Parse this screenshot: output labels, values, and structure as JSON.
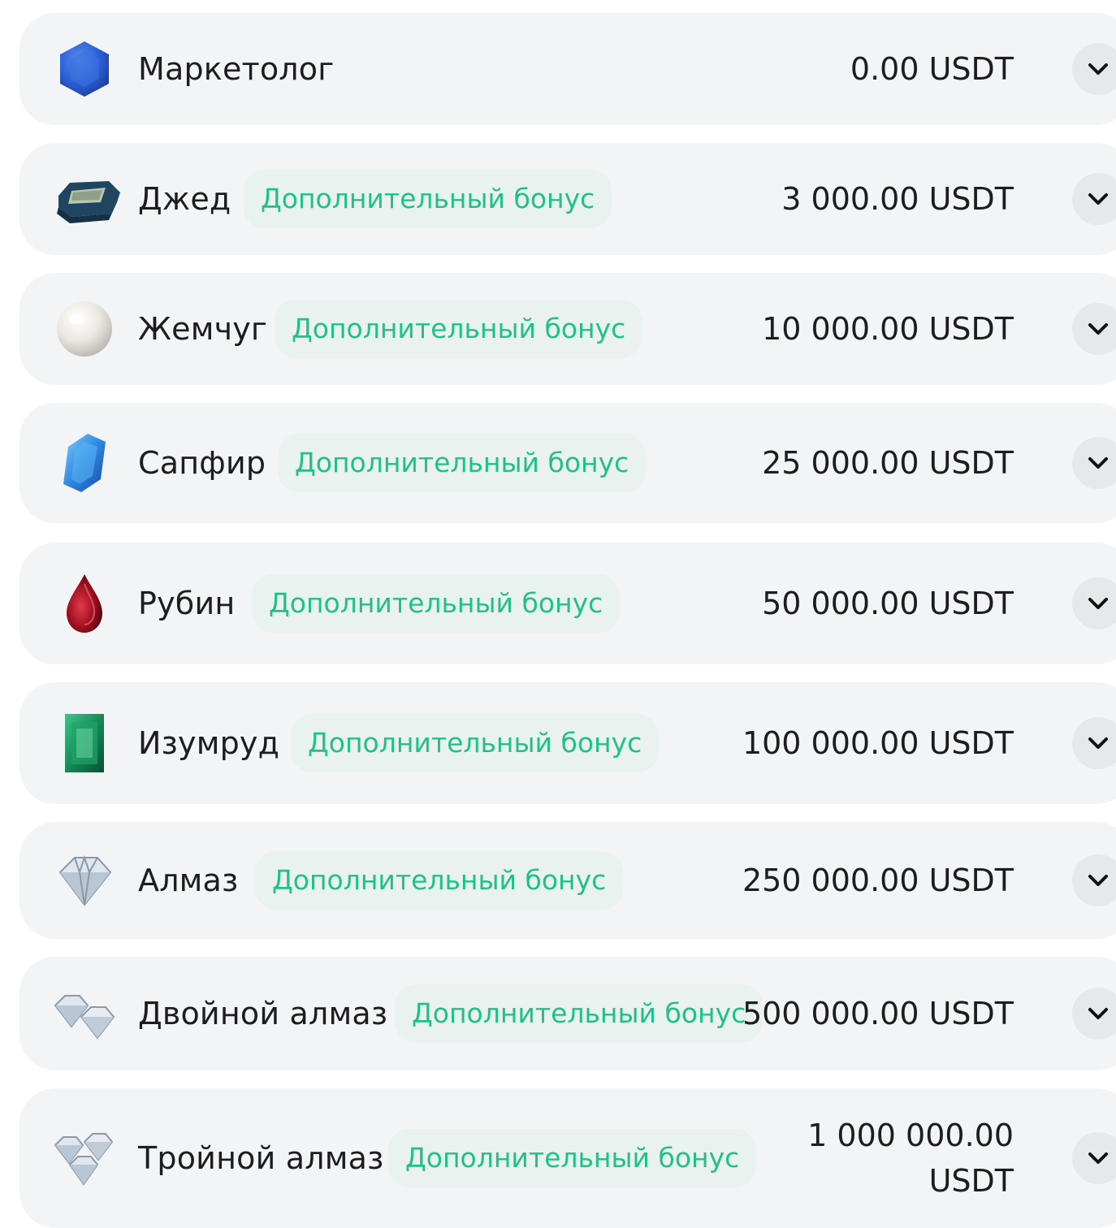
{
  "tiers": [
    {
      "name": "Маркетолог",
      "amount": "0.00 USDT",
      "icon": "blue-hexagon-gem-icon"
    },
    {
      "name": "Джед",
      "bonus": "Дополнительный бонус",
      "amount": "3 000.00 USDT",
      "icon": "jade-gem-icon"
    },
    {
      "name": "Жемчуг",
      "bonus": "Дополнительный бонус",
      "amount": "10 000.00 USDT",
      "icon": "pearl-icon"
    },
    {
      "name": "Сапфир",
      "bonus": "Дополнительный бонус",
      "amount": "25 000.00 USDT",
      "icon": "sapphire-icon"
    },
    {
      "name": "Рубин",
      "bonus": "Дополнительный бонус",
      "amount": "50 000.00 USDT",
      "icon": "ruby-icon"
    },
    {
      "name": "Изумруд",
      "bonus": "Дополнительный бонус",
      "amount": "100 000.00 USDT",
      "icon": "emerald-icon"
    },
    {
      "name": "Алмаз",
      "bonus": "Дополнительный бонус",
      "amount": "250 000.00 USDT",
      "icon": "diamond-icon"
    },
    {
      "name": "Двойной алмаз",
      "bonus": "Дополнительный бонус",
      "amount": "500 000.00 USDT",
      "icon": "double-diamond-icon"
    },
    {
      "name": "Тройной алмаз",
      "bonus": "Дополнительный бонус",
      "amount": "1 000 000.00 USDT",
      "icon": "triple-diamond-icon"
    }
  ],
  "colors": {
    "card_background": "#f3f4f5",
    "bonus_text": "#22c089",
    "bonus_background": "#eaf2ef",
    "text": "#1d1d1f"
  }
}
